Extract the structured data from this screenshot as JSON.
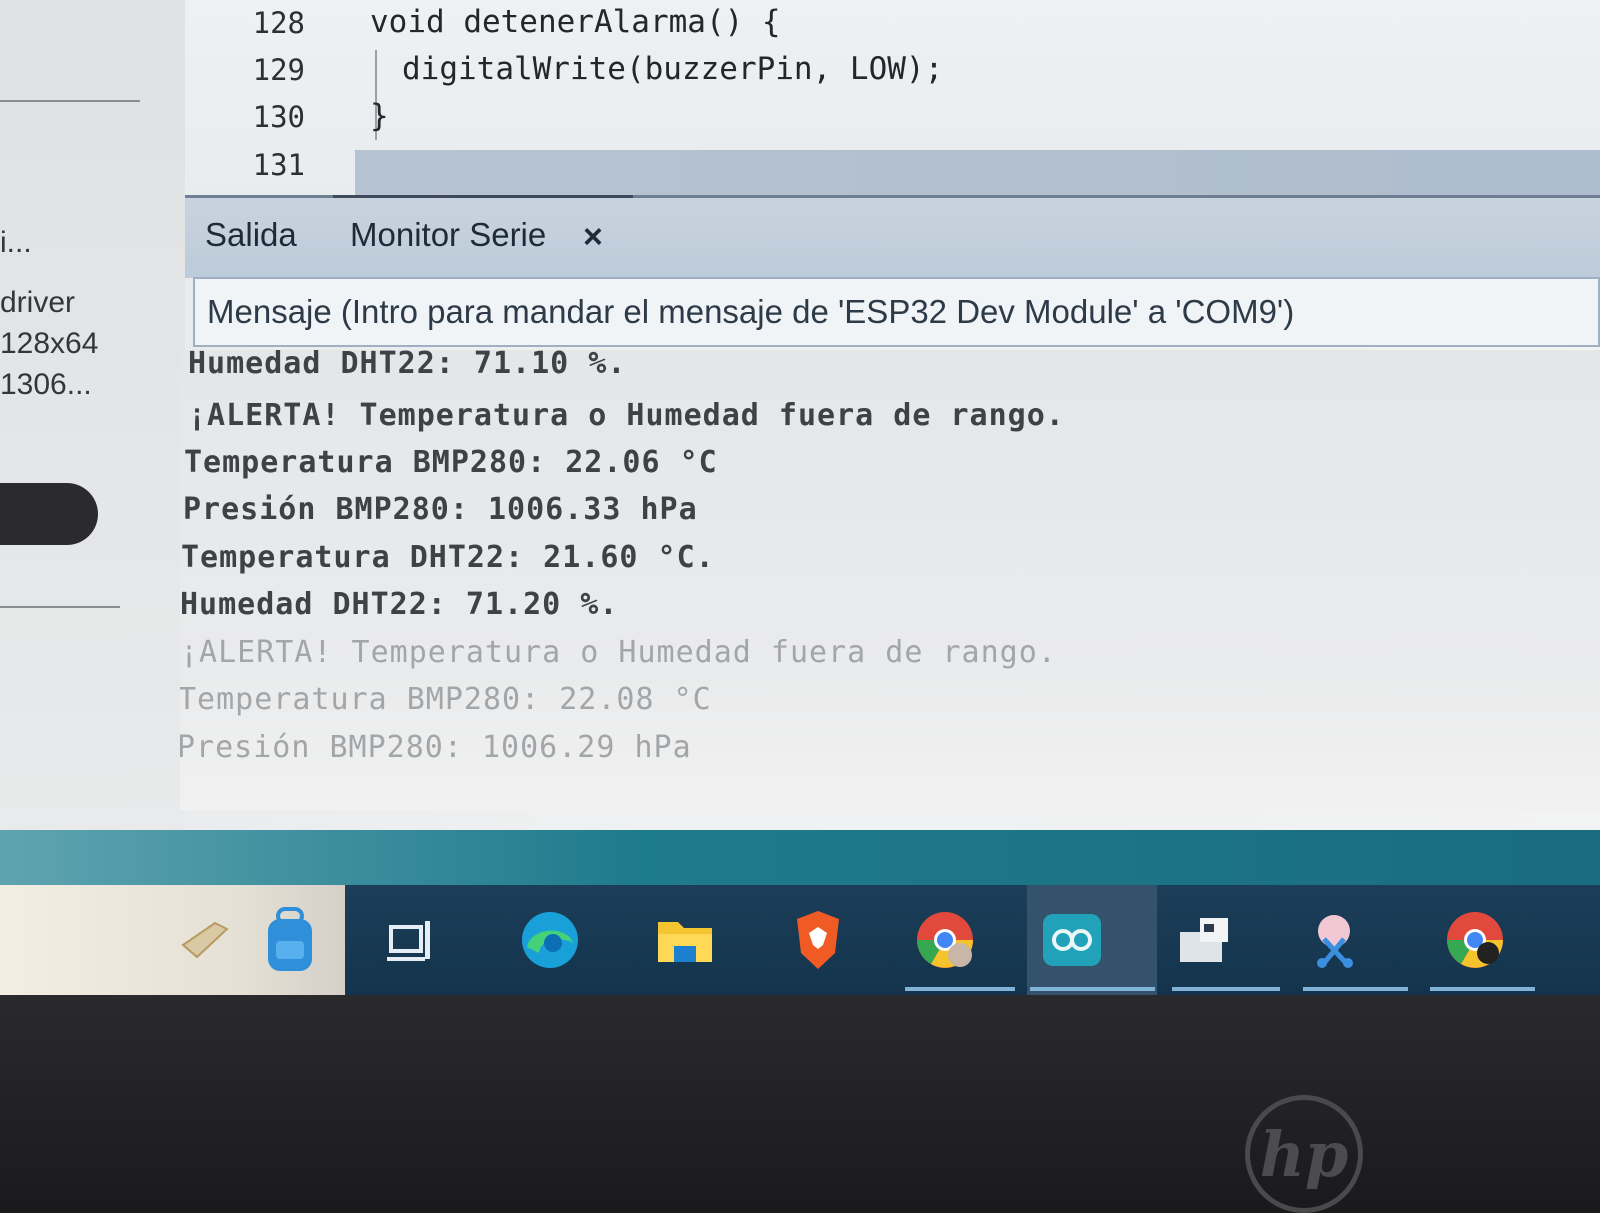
{
  "sidebar": {
    "items": [
      "i...",
      "driver",
      "128x64",
      "1306..."
    ]
  },
  "editor": {
    "lines": [
      {
        "number": "128",
        "code": "void detenerAlarma() {"
      },
      {
        "number": "129",
        "code": "digitalWrite(buzzerPin, LOW);"
      },
      {
        "number": "130",
        "code": "}"
      },
      {
        "number": "131",
        "code": ""
      }
    ]
  },
  "panel": {
    "tabs": [
      {
        "label": "Salida"
      },
      {
        "label": "Monitor Serie",
        "active": true
      }
    ],
    "close_glyph": "×",
    "message_placeholder": "Mensaje (Intro para mandar el mensaje de 'ESP32 Dev Module' a 'COM9')"
  },
  "serial_output": [
    "Humedad DHT22: 71.10 %.",
    "¡ALERTA! Temperatura o Humedad fuera de rango.",
    "Temperatura BMP280: 22.06 °C",
    "Presión BMP280: 1006.33 hPa",
    "Temperatura DHT22: 21.60 °C.",
    "Humedad DHT22: 71.20 %.",
    "¡ALERTA! Temperatura o Humedad fuera de rango.",
    "Temperatura BMP280: 22.08 °C",
    "Presión BMP280: 1006.29 hPa"
  ],
  "taskbar": {
    "icons": [
      "chat-icon",
      "backpack-icon",
      "task-view-icon",
      "edge-icon",
      "file-explorer-icon",
      "brave-icon",
      "chrome-profile-icon",
      "arduino-ide-icon",
      "device-app-icon",
      "snipping-tool-icon",
      "chrome-icon"
    ]
  },
  "colors": {
    "taskbar": "#14344d",
    "panel_tabs": "#bccbd9",
    "teal_strip": "#1e7b8c"
  },
  "bezel": {
    "brand": "hp"
  }
}
